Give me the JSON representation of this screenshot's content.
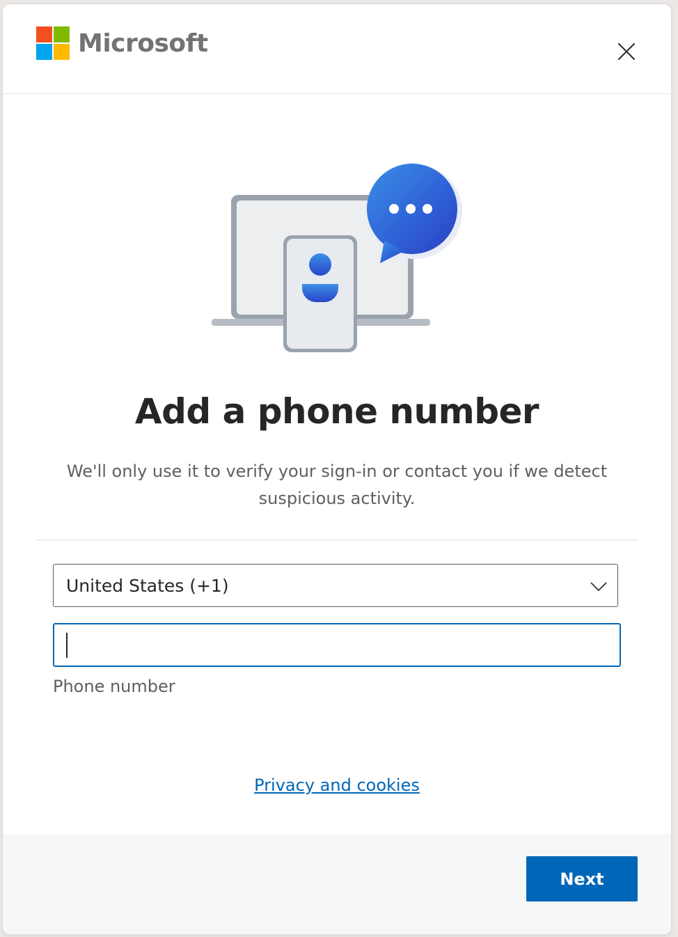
{
  "header": {
    "brand_name": "Microsoft",
    "logo_colors": [
      "#f25022",
      "#7fba00",
      "#00a4ef",
      "#ffb900"
    ],
    "close_icon": "close-icon"
  },
  "main": {
    "illustration_icon": "laptop-phone-chat-icon",
    "title": "Add a phone number",
    "subtitle": "We'll only use it to verify your sign-in or contact you if we detect suspicious activity.",
    "country_select": {
      "value": "United States (+1)",
      "icon": "chevron-down-icon"
    },
    "phone_input": {
      "value": "",
      "label": "Phone number"
    },
    "privacy_link": "Privacy and cookies"
  },
  "footer": {
    "next_label": "Next"
  },
  "colors": {
    "accent": "#0067b8",
    "title_text": "#262626",
    "secondary_text": "#5f5f5f"
  }
}
